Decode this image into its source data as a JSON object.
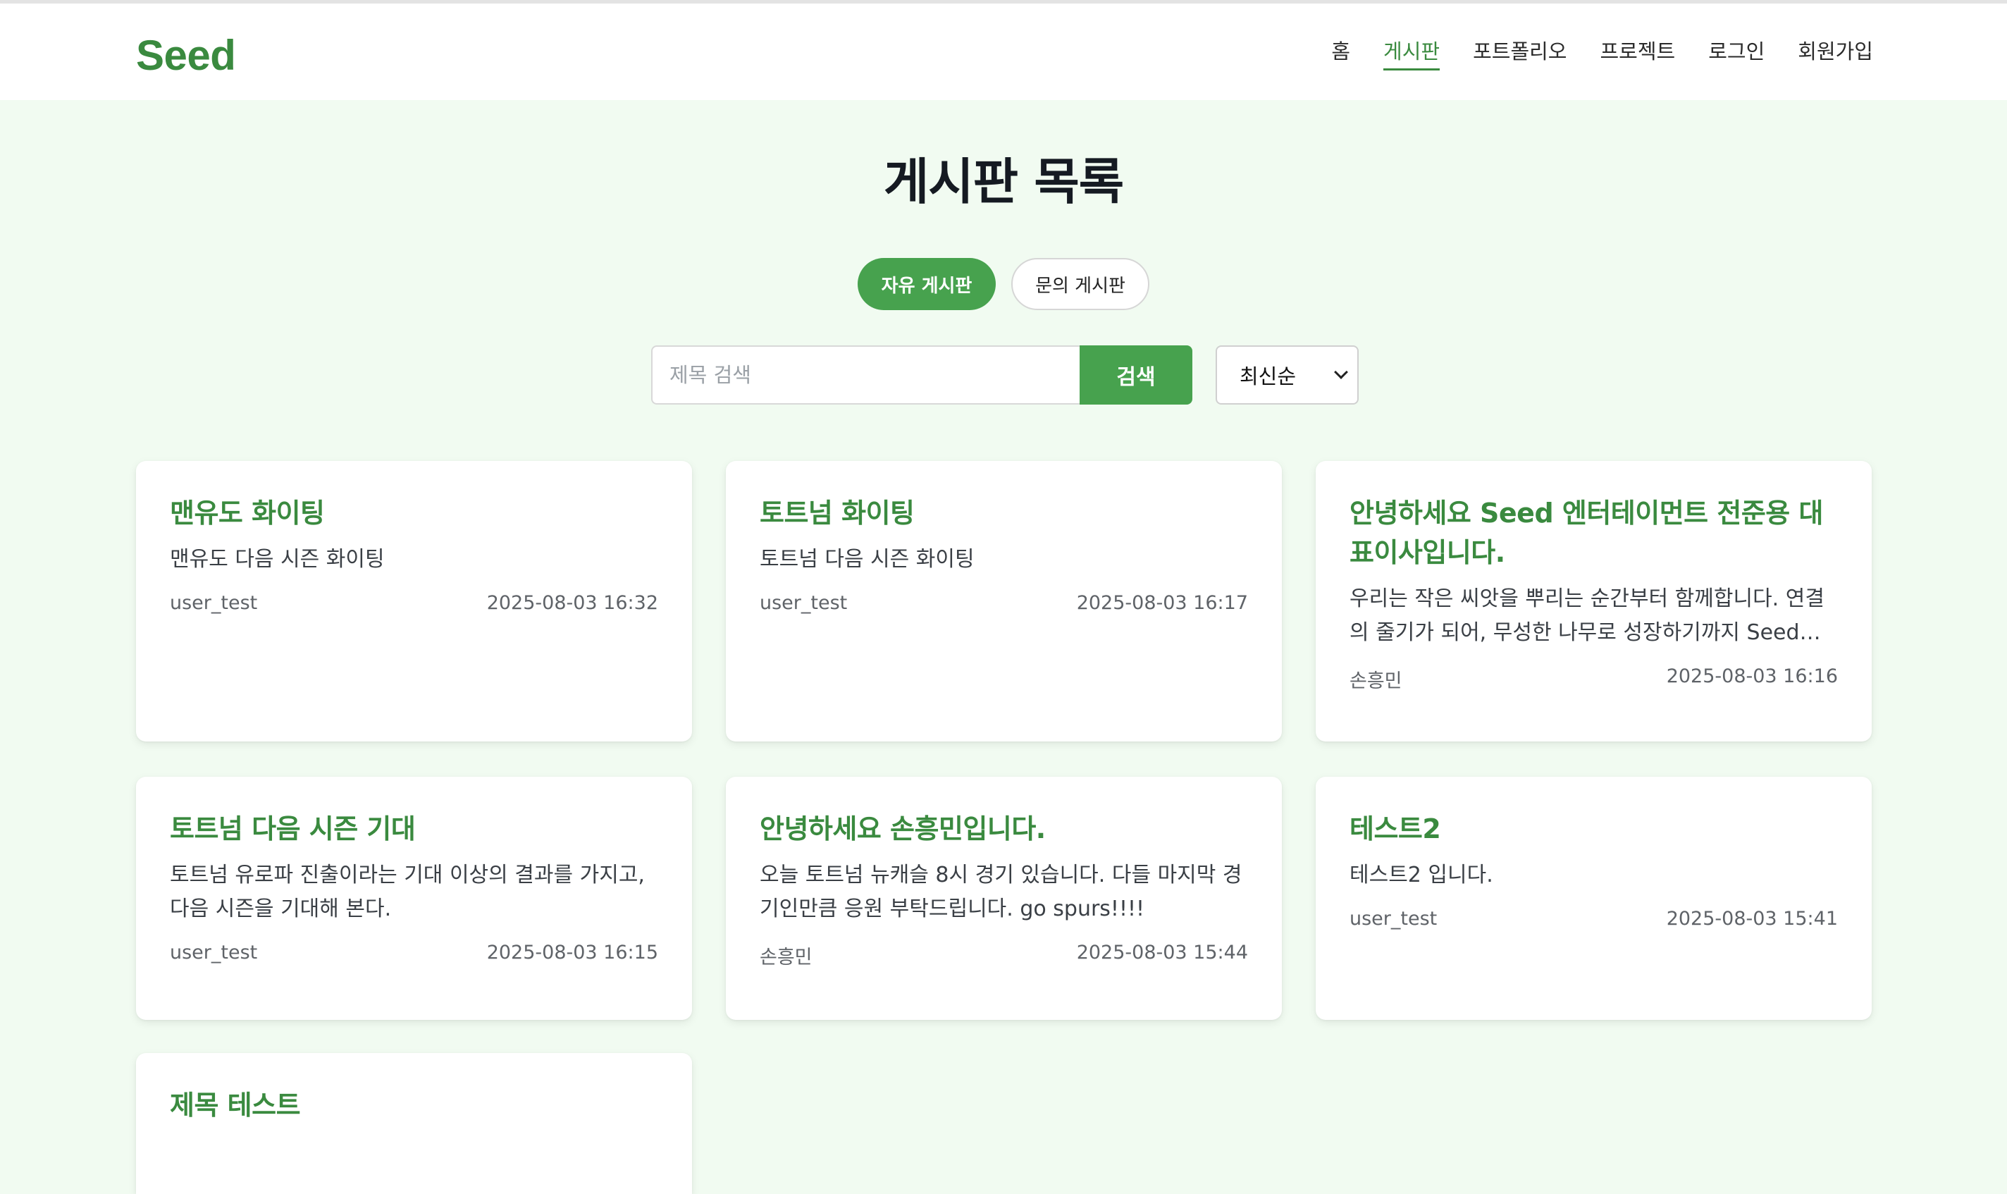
{
  "brand": {
    "name": "Seed",
    "color": "#3a8a3f",
    "accent": "#47a24e"
  },
  "nav": {
    "items": [
      {
        "label": "홈",
        "active": false
      },
      {
        "label": "게시판",
        "active": true
      },
      {
        "label": "포트폴리오",
        "active": false
      },
      {
        "label": "프로젝트",
        "active": false
      },
      {
        "label": "로그인",
        "active": false
      },
      {
        "label": "회원가입",
        "active": false
      }
    ]
  },
  "page": {
    "title": "게시판 목록"
  },
  "tabs": [
    {
      "label": "자유 게시판",
      "active": true
    },
    {
      "label": "문의 게시판",
      "active": false
    }
  ],
  "search": {
    "placeholder": "제목 검색",
    "value": "",
    "button_label": "검색"
  },
  "sort": {
    "selected": "최신순"
  },
  "posts": [
    {
      "title": "맨유도 화이팅",
      "body": "맨유도 다음 시즌 화이팅",
      "author": "user_test",
      "date": "2025-08-03 16:32"
    },
    {
      "title": "토트넘 화이팅",
      "body": "토트넘 다음 시즌 화이팅",
      "author": "user_test",
      "date": "2025-08-03 16:17"
    },
    {
      "title": "안녕하세요 Seed 엔터테이먼트 전준용 대표이사입니다.",
      "body": "우리는 작은 씨앗을 뿌리는 순간부터 함께합니다. 연결의 줄기가 되어, 무성한 나무로 성장하기까지 Seed는...",
      "author": "손흥민",
      "date": "2025-08-03 16:16"
    },
    {
      "title": "토트넘 다음 시즌 기대",
      "body": "토트넘 유로파 진출이라는 기대 이상의 결과를 가지고, 다음 시즌을 기대해 본다.",
      "author": "user_test",
      "date": "2025-08-03 16:15"
    },
    {
      "title": "안녕하세요 손흥민입니다.",
      "body": "오늘 토트넘 뉴캐슬 8시 경기 있습니다. 다들 마지막 경기인만큼 응원 부탁드립니다. go spurs!!!!",
      "author": "손흥민",
      "date": "2025-08-03 15:44"
    },
    {
      "title": "테스트2",
      "body": "테스트2 입니다.",
      "author": "user_test",
      "date": "2025-08-03 15:41"
    },
    {
      "title": "제목 테스트",
      "body": "",
      "author": "",
      "date": ""
    }
  ]
}
